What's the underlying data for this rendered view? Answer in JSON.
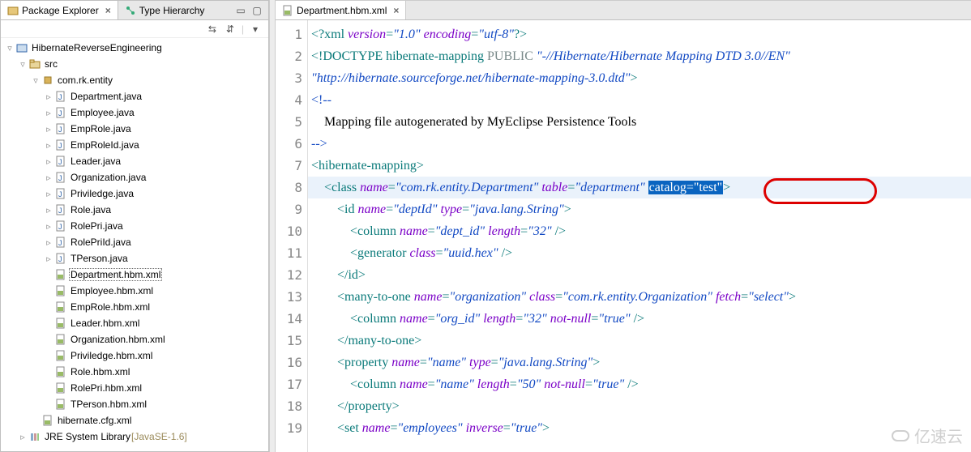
{
  "sidebar": {
    "tabs": [
      {
        "label": "Package Explorer",
        "icon": "package-explorer-icon",
        "active": true,
        "closable": true
      },
      {
        "label": "Type Hierarchy",
        "icon": "type-hierarchy-icon",
        "active": false,
        "closable": false
      }
    ],
    "tree": [
      {
        "depth": 0,
        "twisty": "▿",
        "icon": "project-icon",
        "label": "HibernateReverseEngineering"
      },
      {
        "depth": 1,
        "twisty": "▿",
        "icon": "srcfolder-icon",
        "label": "src"
      },
      {
        "depth": 2,
        "twisty": "▿",
        "icon": "package-icon",
        "label": "com.rk.entity"
      },
      {
        "depth": 3,
        "twisty": "▹",
        "icon": "java-icon",
        "label": "Department.java"
      },
      {
        "depth": 3,
        "twisty": "▹",
        "icon": "java-icon",
        "label": "Employee.java"
      },
      {
        "depth": 3,
        "twisty": "▹",
        "icon": "java-icon",
        "label": "EmpRole.java"
      },
      {
        "depth": 3,
        "twisty": "▹",
        "icon": "java-icon",
        "label": "EmpRoleId.java"
      },
      {
        "depth": 3,
        "twisty": "▹",
        "icon": "java-icon",
        "label": "Leader.java"
      },
      {
        "depth": 3,
        "twisty": "▹",
        "icon": "java-icon",
        "label": "Organization.java"
      },
      {
        "depth": 3,
        "twisty": "▹",
        "icon": "java-icon",
        "label": "Priviledge.java"
      },
      {
        "depth": 3,
        "twisty": "▹",
        "icon": "java-icon",
        "label": "Role.java"
      },
      {
        "depth": 3,
        "twisty": "▹",
        "icon": "java-icon",
        "label": "RolePri.java"
      },
      {
        "depth": 3,
        "twisty": "▹",
        "icon": "java-icon",
        "label": "RolePriId.java"
      },
      {
        "depth": 3,
        "twisty": "▹",
        "icon": "java-icon",
        "label": "TPerson.java"
      },
      {
        "depth": 3,
        "twisty": "",
        "icon": "hbm-icon",
        "label": "Department.hbm.xml",
        "selected": true
      },
      {
        "depth": 3,
        "twisty": "",
        "icon": "hbm-icon",
        "label": "Employee.hbm.xml"
      },
      {
        "depth": 3,
        "twisty": "",
        "icon": "hbm-icon",
        "label": "EmpRole.hbm.xml"
      },
      {
        "depth": 3,
        "twisty": "",
        "icon": "hbm-icon",
        "label": "Leader.hbm.xml"
      },
      {
        "depth": 3,
        "twisty": "",
        "icon": "hbm-icon",
        "label": "Organization.hbm.xml"
      },
      {
        "depth": 3,
        "twisty": "",
        "icon": "hbm-icon",
        "label": "Priviledge.hbm.xml"
      },
      {
        "depth": 3,
        "twisty": "",
        "icon": "hbm-icon",
        "label": "Role.hbm.xml"
      },
      {
        "depth": 3,
        "twisty": "",
        "icon": "hbm-icon",
        "label": "RolePri.hbm.xml"
      },
      {
        "depth": 3,
        "twisty": "",
        "icon": "hbm-icon",
        "label": "TPerson.hbm.xml"
      },
      {
        "depth": 2,
        "twisty": "",
        "icon": "hbm-icon",
        "label": "hibernate.cfg.xml"
      },
      {
        "depth": 1,
        "twisty": "▹",
        "icon": "library-icon",
        "label": "JRE System Library",
        "annotation": " [JavaSE-1.6]"
      }
    ]
  },
  "editor": {
    "tab": {
      "label": "Department.hbm.xml",
      "icon": "hbm-icon"
    },
    "lines": [
      {
        "n": 1,
        "tokens": [
          {
            "c": "t-pi",
            "t": "<?"
          },
          {
            "c": "t-tag",
            "t": "xml "
          },
          {
            "c": "t-attr",
            "t": "version"
          },
          {
            "c": "t-tag",
            "t": "="
          },
          {
            "c": "t-str",
            "t": "\"1.0\""
          },
          {
            "c": "t-tag",
            "t": " "
          },
          {
            "c": "t-attr",
            "t": "encoding"
          },
          {
            "c": "t-tag",
            "t": "="
          },
          {
            "c": "t-str",
            "t": "\"utf-8\""
          },
          {
            "c": "t-pi",
            "t": "?>"
          }
        ]
      },
      {
        "n": 2,
        "tokens": [
          {
            "c": "t-tag",
            "t": "<!DOCTYPE hibernate-mapping "
          },
          {
            "c": "t-kw",
            "t": "PUBLIC "
          },
          {
            "c": "t-str",
            "t": "\"-//Hibernate/Hibernate Mapping DTD 3.0//EN\""
          }
        ]
      },
      {
        "n": 3,
        "tokens": [
          {
            "c": "t-str",
            "t": "\"http://hibernate.sourceforge.net/hibernate-mapping-3.0.dtd\""
          },
          {
            "c": "t-tag",
            "t": ">"
          }
        ]
      },
      {
        "n": 4,
        "tokens": [
          {
            "c": "t-comm",
            "t": "<!--"
          }
        ]
      },
      {
        "n": 5,
        "tokens": [
          {
            "c": "t-text",
            "t": "    Mapping file "
          },
          {
            "c": "t-text",
            "t": "autogenerated"
          },
          {
            "c": "t-text",
            "t": " by MyEclipse Persistence Tools"
          }
        ]
      },
      {
        "n": 6,
        "tokens": [
          {
            "c": "t-comm",
            "t": "-->"
          }
        ]
      },
      {
        "n": 7,
        "tokens": [
          {
            "c": "t-tag",
            "t": "<hibernate-mapping>"
          }
        ]
      },
      {
        "n": 8,
        "cursor": true,
        "tokens": [
          {
            "c": "t-tag",
            "t": "    <class "
          },
          {
            "c": "t-attr",
            "t": "name"
          },
          {
            "c": "t-tag",
            "t": "="
          },
          {
            "c": "t-str",
            "t": "\"com.rk.entity.Department\""
          },
          {
            "c": "t-tag",
            "t": " "
          },
          {
            "c": "t-attr",
            "t": "table"
          },
          {
            "c": "t-tag",
            "t": "="
          },
          {
            "c": "t-str",
            "t": "\"department\""
          },
          {
            "c": "t-tag",
            "t": " "
          },
          {
            "c": "hl-sel",
            "t": "catalog=\"test\""
          },
          {
            "c": "t-tag",
            "t": ">"
          }
        ]
      },
      {
        "n": 9,
        "tokens": [
          {
            "c": "t-tag",
            "t": "        <id "
          },
          {
            "c": "t-attr",
            "t": "name"
          },
          {
            "c": "t-tag",
            "t": "="
          },
          {
            "c": "t-str",
            "t": "\"deptId\""
          },
          {
            "c": "t-tag",
            "t": " "
          },
          {
            "c": "t-attr",
            "t": "type"
          },
          {
            "c": "t-tag",
            "t": "="
          },
          {
            "c": "t-str",
            "t": "\"java.lang.String\""
          },
          {
            "c": "t-tag",
            "t": ">"
          }
        ]
      },
      {
        "n": 10,
        "tokens": [
          {
            "c": "t-tag",
            "t": "            <column "
          },
          {
            "c": "t-attr",
            "t": "name"
          },
          {
            "c": "t-tag",
            "t": "="
          },
          {
            "c": "t-str",
            "t": "\"dept_id\""
          },
          {
            "c": "t-tag",
            "t": " "
          },
          {
            "c": "t-attr",
            "t": "length"
          },
          {
            "c": "t-tag",
            "t": "="
          },
          {
            "c": "t-str",
            "t": "\"32\""
          },
          {
            "c": "t-tag",
            "t": " />"
          }
        ]
      },
      {
        "n": 11,
        "tokens": [
          {
            "c": "t-tag",
            "t": "            <generator "
          },
          {
            "c": "t-attr",
            "t": "class"
          },
          {
            "c": "t-tag",
            "t": "="
          },
          {
            "c": "t-str",
            "t": "\"uuid.hex\""
          },
          {
            "c": "t-tag",
            "t": " />"
          }
        ]
      },
      {
        "n": 12,
        "tokens": [
          {
            "c": "t-tag",
            "t": "        </id>"
          }
        ]
      },
      {
        "n": 13,
        "tokens": [
          {
            "c": "t-tag",
            "t": "        <many-to-one "
          },
          {
            "c": "t-attr",
            "t": "name"
          },
          {
            "c": "t-tag",
            "t": "="
          },
          {
            "c": "t-str",
            "t": "\"organization\""
          },
          {
            "c": "t-tag",
            "t": " "
          },
          {
            "c": "t-attr",
            "t": "class"
          },
          {
            "c": "t-tag",
            "t": "="
          },
          {
            "c": "t-str",
            "t": "\"com.rk.entity.Organization\""
          },
          {
            "c": "t-tag",
            "t": " "
          },
          {
            "c": "t-attr",
            "t": "fetch"
          },
          {
            "c": "t-tag",
            "t": "="
          },
          {
            "c": "t-str",
            "t": "\"select\""
          },
          {
            "c": "t-tag",
            "t": ">"
          }
        ]
      },
      {
        "n": 14,
        "tokens": [
          {
            "c": "t-tag",
            "t": "            <column "
          },
          {
            "c": "t-attr",
            "t": "name"
          },
          {
            "c": "t-tag",
            "t": "="
          },
          {
            "c": "t-str",
            "t": "\"org_id\""
          },
          {
            "c": "t-tag",
            "t": " "
          },
          {
            "c": "t-attr",
            "t": "length"
          },
          {
            "c": "t-tag",
            "t": "="
          },
          {
            "c": "t-str",
            "t": "\"32\""
          },
          {
            "c": "t-tag",
            "t": " "
          },
          {
            "c": "t-attr",
            "t": "not-null"
          },
          {
            "c": "t-tag",
            "t": "="
          },
          {
            "c": "t-str",
            "t": "\"true\""
          },
          {
            "c": "t-tag",
            "t": " />"
          }
        ]
      },
      {
        "n": 15,
        "tokens": [
          {
            "c": "t-tag",
            "t": "        </many-to-one>"
          }
        ]
      },
      {
        "n": 16,
        "tokens": [
          {
            "c": "t-tag",
            "t": "        <property "
          },
          {
            "c": "t-attr",
            "t": "name"
          },
          {
            "c": "t-tag",
            "t": "="
          },
          {
            "c": "t-str",
            "t": "\"name\""
          },
          {
            "c": "t-tag",
            "t": " "
          },
          {
            "c": "t-attr",
            "t": "type"
          },
          {
            "c": "t-tag",
            "t": "="
          },
          {
            "c": "t-str",
            "t": "\"java.lang.String\""
          },
          {
            "c": "t-tag",
            "t": ">"
          }
        ]
      },
      {
        "n": 17,
        "tokens": [
          {
            "c": "t-tag",
            "t": "            <column "
          },
          {
            "c": "t-attr",
            "t": "name"
          },
          {
            "c": "t-tag",
            "t": "="
          },
          {
            "c": "t-str",
            "t": "\"name\""
          },
          {
            "c": "t-tag",
            "t": " "
          },
          {
            "c": "t-attr",
            "t": "length"
          },
          {
            "c": "t-tag",
            "t": "="
          },
          {
            "c": "t-str",
            "t": "\"50\""
          },
          {
            "c": "t-tag",
            "t": " "
          },
          {
            "c": "t-attr",
            "t": "not-null"
          },
          {
            "c": "t-tag",
            "t": "="
          },
          {
            "c": "t-str",
            "t": "\"true\""
          },
          {
            "c": "t-tag",
            "t": " />"
          }
        ]
      },
      {
        "n": 18,
        "tokens": [
          {
            "c": "t-tag",
            "t": "        </property>"
          }
        ]
      },
      {
        "n": 19,
        "tokens": [
          {
            "c": "t-tag",
            "t": "        <set "
          },
          {
            "c": "t-attr",
            "t": "name"
          },
          {
            "c": "t-tag",
            "t": "="
          },
          {
            "c": "t-str",
            "t": "\"employees\""
          },
          {
            "c": "t-tag",
            "t": " "
          },
          {
            "c": "t-attr",
            "t": "inverse"
          },
          {
            "c": "t-tag",
            "t": "="
          },
          {
            "c": "t-str",
            "t": "\"true\""
          },
          {
            "c": "t-tag",
            "t": ">"
          }
        ]
      }
    ]
  },
  "watermark": "亿速云"
}
